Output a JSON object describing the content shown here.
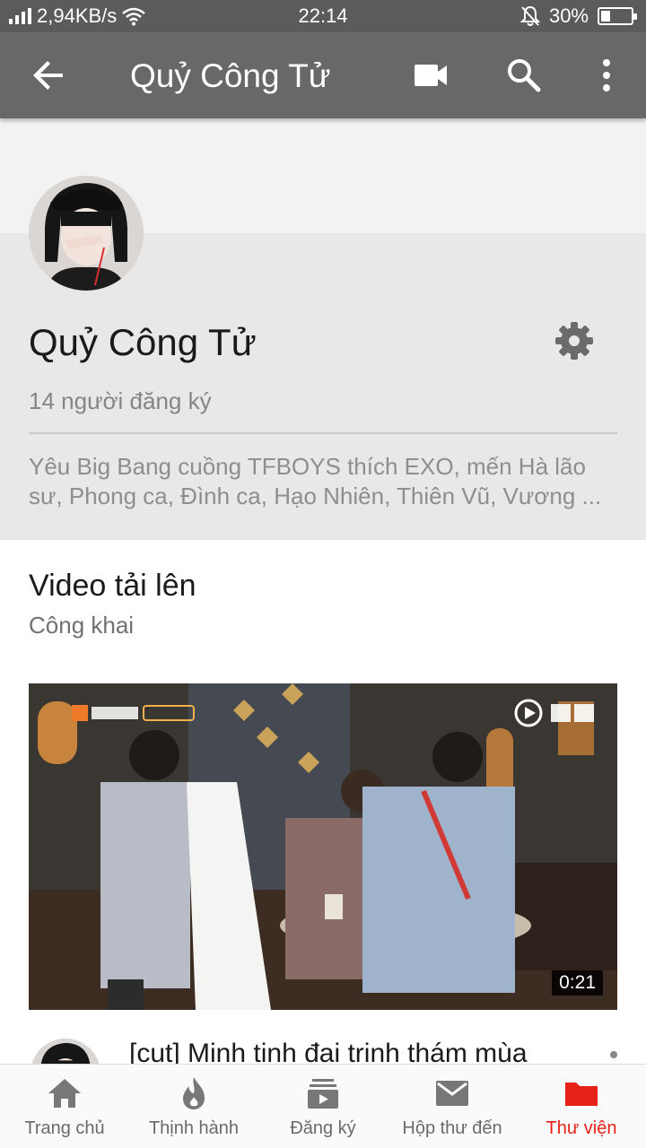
{
  "status_bar": {
    "speed": "2,94KB/s",
    "time": "22:14",
    "battery": "30%",
    "battery_level": 0.3
  },
  "app_bar": {
    "title": "Quỷ Công Tử",
    "icons": [
      "back-arrow-icon",
      "video-camera-icon",
      "search-icon",
      "more-vert-icon"
    ]
  },
  "channel": {
    "name": "Quỷ Công Tử",
    "subscribers": "14 người đăng ký",
    "description": "Yêu Big Bang cuồng TFBOYS thích EXO, mến Hà lão sư, Phong ca, Đình ca, Hạo Nhiên, Thiên Vũ, Vương ..."
  },
  "uploads": {
    "title": "Video tải lên",
    "visibility": "Công khai",
    "video": {
      "duration": "0:21",
      "title": "[cut] Minh tinh đại trinh thám mùa"
    }
  },
  "bottom_nav": {
    "items": [
      {
        "label": "Trang chủ",
        "icon": "home-icon"
      },
      {
        "label": "Thịnh hành",
        "icon": "flame-icon"
      },
      {
        "label": "Đăng ký",
        "icon": "subscriptions-icon"
      },
      {
        "label": "Hộp thư đến",
        "icon": "mail-icon"
      },
      {
        "label": "Thư viện",
        "icon": "folder-icon",
        "active": true
      }
    ]
  },
  "colors": {
    "app_bar": "#686868",
    "status_bar": "#5b5b5b",
    "accent": "#e62117"
  }
}
